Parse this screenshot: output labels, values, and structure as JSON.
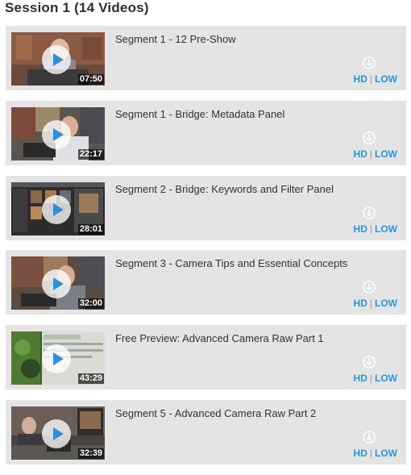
{
  "session": {
    "title": "Session 1 (14 Videos)"
  },
  "videos": [
    {
      "title": "Segment 1 - 12 Pre-Show",
      "duration": "07:50",
      "hd": "HD",
      "low": "LOW",
      "separator": "|",
      "thumb": "studio",
      "icon": "download-icon"
    },
    {
      "title": "Segment 1 - Bridge: Metadata Panel",
      "duration": "22:17",
      "hd": "HD",
      "low": "LOW",
      "separator": "|",
      "thumb": "presenter",
      "icon": "download-icon"
    },
    {
      "title": "Segment 2 - Bridge: Keywords and Filter Panel",
      "duration": "28:01",
      "hd": "HD",
      "low": "LOW",
      "separator": "|",
      "thumb": "software",
      "icon": "download-icon"
    },
    {
      "title": "Segment 3 - Camera Tips and Essential Concepts",
      "duration": "32:00",
      "hd": "HD",
      "low": "LOW",
      "separator": "|",
      "thumb": "studio",
      "icon": "download-icon"
    },
    {
      "title": "Free Preview: Advanced Camera Raw Part 1",
      "duration": "43:29",
      "hd": "HD",
      "low": "LOW",
      "separator": "|",
      "thumb": "raw",
      "icon": "download-icon"
    },
    {
      "title": "Segment 5 - Advanced Camera Raw Part 2",
      "duration": "32:39",
      "hd": "HD",
      "low": "LOW",
      "separator": "|",
      "thumb": "desk",
      "icon": "download-icon"
    }
  ],
  "colors": {
    "link": "#2b95dc",
    "card": "#e4e4e4",
    "play": "#2f8fd8"
  }
}
